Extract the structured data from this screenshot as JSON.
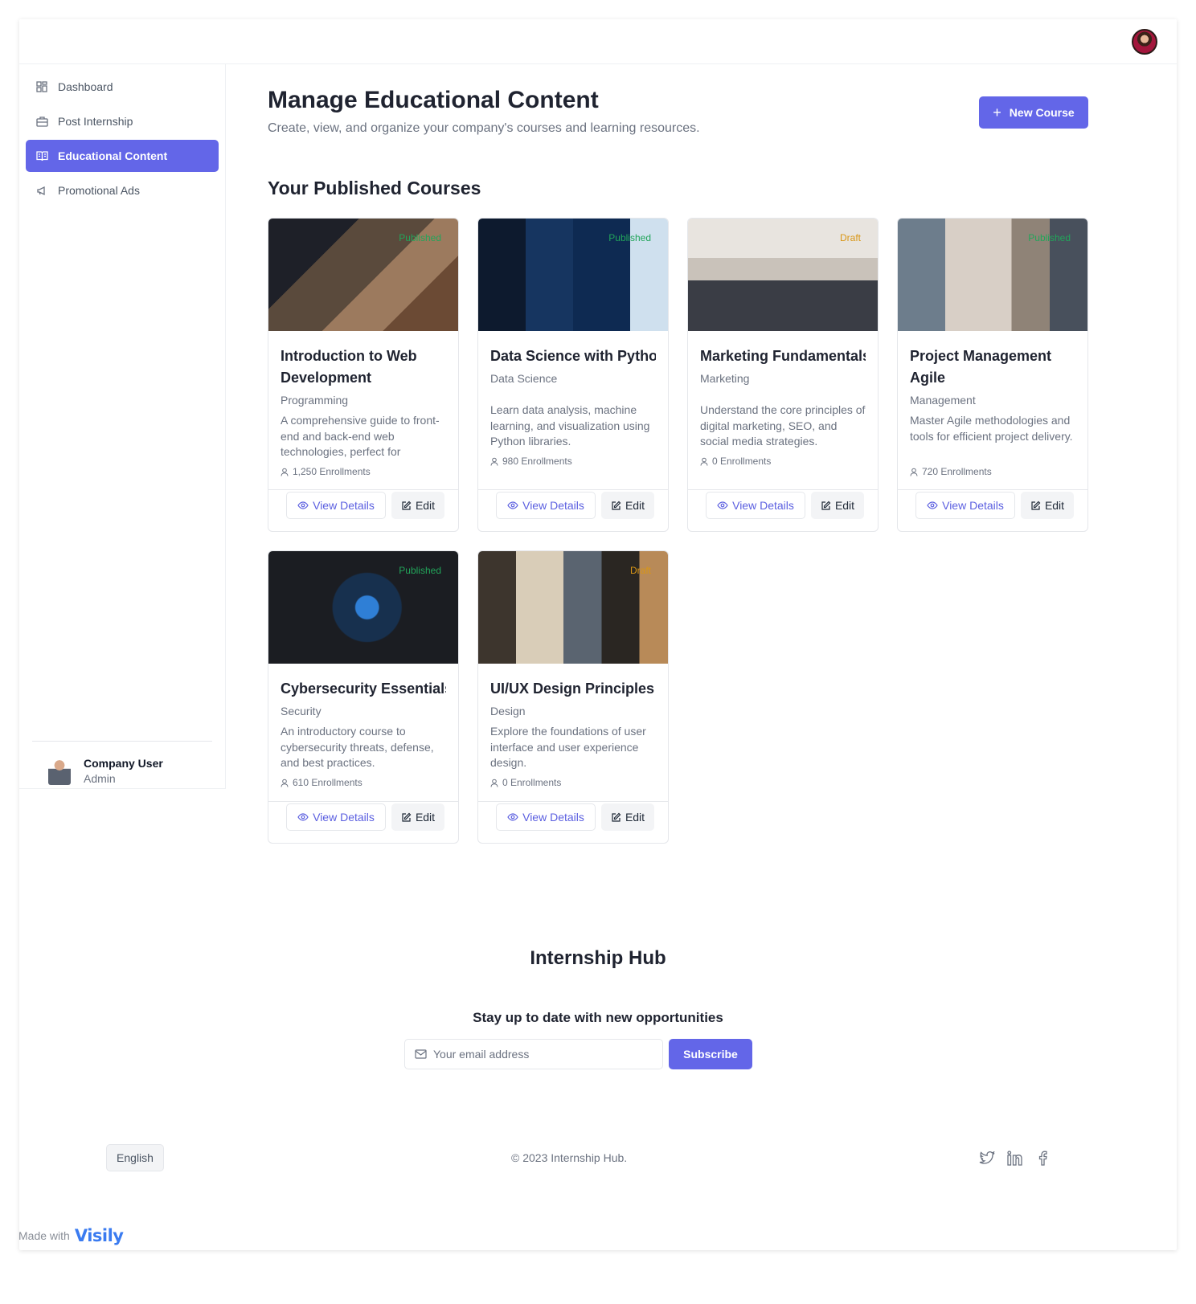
{
  "header": {
    "avatar_label": "User avatar"
  },
  "sidebar": {
    "items": [
      {
        "label": "Dashboard",
        "icon": "grid-icon",
        "active": false
      },
      {
        "label": "Post Internship",
        "icon": "briefcase-icon",
        "active": false
      },
      {
        "label": "Educational Content",
        "icon": "book-open-icon",
        "active": true
      },
      {
        "label": "Promotional Ads",
        "icon": "megaphone-icon",
        "active": false
      }
    ],
    "user": {
      "name": "Company User",
      "role": "Admin"
    }
  },
  "main": {
    "title": "Manage Educational Content",
    "subtitle": "Create, view, and organize your company's courses and learning resources.",
    "new_course_label": "New Course",
    "section_title": "Your Published Courses",
    "view_label": "View Details",
    "edit_label": "Edit",
    "courses": [
      {
        "title": "Introduction to Web Development",
        "category": "Programming",
        "description": "A comprehensive guide to front-end and back-end web technologies, perfect for",
        "enrollments": "1,250 Enrollments",
        "status": "Published"
      },
      {
        "title": "Data Science with Pytho",
        "category": "Data Science",
        "description": "Learn data analysis, machine learning, and visualization using Python libraries.",
        "enrollments": "980 Enrollments",
        "status": "Published"
      },
      {
        "title": "Marketing Fundamentals",
        "category": "Marketing",
        "description": "Understand the core principles of digital marketing, SEO, and social media strategies.",
        "enrollments": "0 Enrollments",
        "status": "Draft"
      },
      {
        "title": "Project Management Agile",
        "category": "Management",
        "description": "Master Agile methodologies and tools for efficient project delivery.",
        "enrollments": "720 Enrollments",
        "status": "Published"
      },
      {
        "title": "Cybersecurity Essentials",
        "category": "Security",
        "description": "An introductory course to cybersecurity threats, defense, and best practices.",
        "enrollments": "610 Enrollments",
        "status": "Published"
      },
      {
        "title": "UI/UX Design Principles",
        "category": "Design",
        "description": "Explore the foundations of user interface and user experience design.",
        "enrollments": "0 Enrollments",
        "status": "Draft"
      }
    ]
  },
  "footer": {
    "brand": "Internship Hub",
    "tagline": "Stay up to date with new opportunities",
    "email_placeholder": "Your email address",
    "subscribe_label": "Subscribe",
    "language": "English",
    "copyright": "© 2023 Internship Hub.",
    "social": [
      "twitter-icon",
      "linkedin-icon",
      "facebook-icon"
    ]
  },
  "watermark": {
    "made_with": "Made with",
    "brand": "Visily"
  },
  "colors": {
    "accent": "#6366e8",
    "published": "#22a55a",
    "draft": "#d99616"
  }
}
